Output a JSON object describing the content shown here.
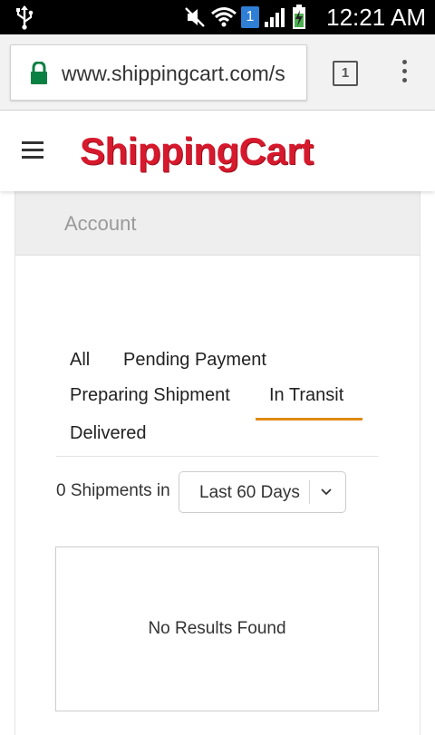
{
  "status_bar": {
    "time": "12:21 AM",
    "notification_count": "1"
  },
  "browser": {
    "url": "www.shippingcart.com/s",
    "tab_count": "1"
  },
  "site": {
    "logo_text": "ShippingCart",
    "brand_color": "#d7192d"
  },
  "account": {
    "title": "Account"
  },
  "filters": {
    "tabs": [
      {
        "label": "All",
        "active": false
      },
      {
        "label": "Pending Payment",
        "active": false
      },
      {
        "label": "Preparing Shipment",
        "active": false
      },
      {
        "label": "In Transit",
        "active": true
      },
      {
        "label": "Delivered",
        "active": false
      }
    ],
    "accent_color": "#e08a14"
  },
  "shipments": {
    "count_label": "0 Shipments in",
    "range_selected": "Last 60 Days",
    "empty_message": "No Results Found"
  }
}
